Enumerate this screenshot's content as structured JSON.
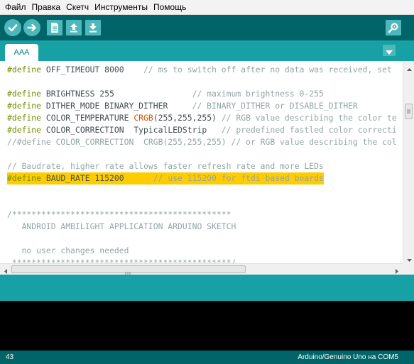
{
  "menu": {
    "items": [
      "Файл",
      "Правка",
      "Скетч",
      "Инструменты",
      "Помощь"
    ]
  },
  "toolbar": {
    "buttons": [
      "verify-icon",
      "upload-icon",
      "new-icon",
      "open-icon",
      "save-icon"
    ],
    "serial_monitor": "serial-monitor-icon"
  },
  "tabs": [
    {
      "label": "AAA"
    }
  ],
  "editor": {
    "lines": [
      {
        "parts": [
          [
            "kw",
            "#define"
          ],
          [
            "",
            " OFF_TIMEOUT 8000    "
          ],
          [
            "cm",
            "// ms to switch off after no data was received, set"
          ]
        ]
      },
      {
        "parts": []
      },
      {
        "parts": [
          [
            "kw",
            "#define"
          ],
          [
            "",
            " BRIGHTNESS 255                "
          ],
          [
            "cm",
            "// maximum brightness 0-255"
          ]
        ]
      },
      {
        "parts": [
          [
            "kw",
            "#define"
          ],
          [
            "",
            " DITHER_MODE BINARY_DITHER     "
          ],
          [
            "cm",
            "// BINARY_DITHER or DISABLE_DITHER"
          ]
        ]
      },
      {
        "parts": [
          [
            "kw",
            "#define"
          ],
          [
            "",
            " COLOR_TEMPERATURE "
          ],
          [
            "fn",
            "CRGB"
          ],
          [
            "",
            "(255,255,255) "
          ],
          [
            "cm",
            "// RGB value describing the color te"
          ]
        ]
      },
      {
        "parts": [
          [
            "kw",
            "#define"
          ],
          [
            "",
            " COLOR_CORRECTION  TypicalLEDStrip   "
          ],
          [
            "cm",
            "// predefined fastled color correcti"
          ]
        ]
      },
      {
        "parts": [
          [
            "cm",
            "//#define COLOR_CORRECTION  CRGB(255,255,255) // or RGB value describing the col"
          ]
        ]
      },
      {
        "parts": []
      },
      {
        "parts": [
          [
            "cm",
            "// Baudrate, higher rate allows faster refresh rate and more LEDs"
          ]
        ]
      },
      {
        "parts": [
          [
            "kw",
            "#define"
          ],
          [
            "",
            " BAUD_RATE 115200      "
          ],
          [
            "cm",
            "// use 115200 for ftdi based boards"
          ]
        ],
        "highlight": true
      },
      {
        "parts": []
      },
      {
        "parts": []
      },
      {
        "parts": [
          [
            "cm",
            "/*********************************************"
          ]
        ]
      },
      {
        "parts": [
          [
            "cm",
            "   ANDROID AMBILIGHT APPLICATION ARDUINO SKETCH"
          ]
        ]
      },
      {
        "parts": []
      },
      {
        "parts": [
          [
            "cm",
            "   no user changes needed"
          ]
        ]
      },
      {
        "parts": [
          [
            "cm",
            " *********************************************/"
          ]
        ]
      }
    ]
  },
  "statusbar": {
    "line_number": "43",
    "board": "Arduino/Genuino Uno на COM5"
  }
}
